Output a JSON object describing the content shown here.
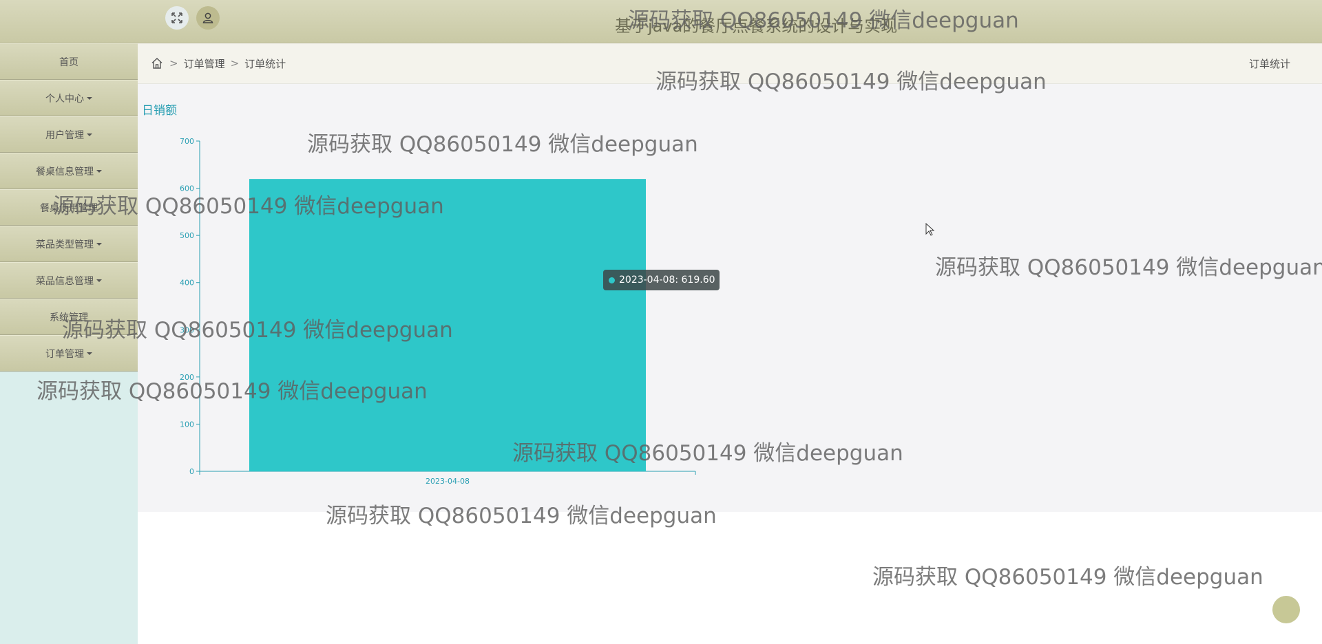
{
  "header": {
    "title": "基于java的餐厅点餐系统的设计与实现",
    "icons": [
      "fullscreen-icon",
      "user-icon"
    ]
  },
  "sidebar": {
    "items": [
      {
        "label": "首页",
        "has_caret": false
      },
      {
        "label": "个人中心",
        "has_caret": true
      },
      {
        "label": "用户管理",
        "has_caret": true
      },
      {
        "label": "餐桌信息管理",
        "has_caret": true
      },
      {
        "label": "餐桌使用管理",
        "has_caret": false
      },
      {
        "label": "菜品类型管理",
        "has_caret": true
      },
      {
        "label": "菜品信息管理",
        "has_caret": true
      },
      {
        "label": "系统管理",
        "has_caret": false
      },
      {
        "label": "订单管理",
        "has_caret": true
      }
    ]
  },
  "breadcrumb": {
    "separator": ">",
    "items": [
      "订单管理",
      "订单统计"
    ],
    "right_label": "订单统计"
  },
  "chart_data": {
    "type": "bar",
    "title": "日销额",
    "categories": [
      "2023-04-08"
    ],
    "values": [
      619.6
    ],
    "ylim": [
      0,
      700
    ],
    "yticks": [
      0,
      100,
      200,
      300,
      400,
      500,
      600,
      700
    ],
    "color": "#2ec7c9",
    "axis_color": "#2a9fb3",
    "grid": false,
    "tooltip": "2023-04-08: 619.60"
  },
  "watermark": "源码获取 QQ86050149 微信deepguan"
}
